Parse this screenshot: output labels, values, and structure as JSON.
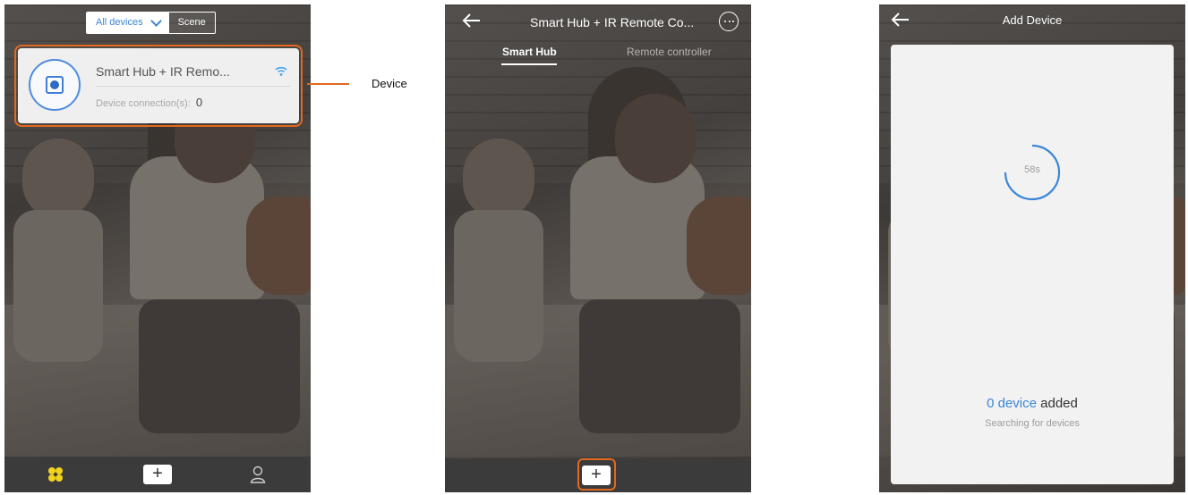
{
  "phone1": {
    "segmented": {
      "all_devices": "All devices",
      "scene": "Scene"
    },
    "device_card": {
      "name": "Smart Hub + IR Remo...",
      "connections_label": "Device connection(s):",
      "connections_count": "0"
    },
    "callout_label": "Device",
    "tabbar": {
      "plus": "+"
    }
  },
  "phone2": {
    "title": "Smart Hub + IR Remote Co...",
    "tabs": [
      "Smart Hub",
      "Remote controller"
    ],
    "plus": "+"
  },
  "phone3": {
    "title": "Add Device",
    "countdown": "58s",
    "added_count": "0 device",
    "added_suffix": " added",
    "searching": "Searching for devices"
  },
  "colors": {
    "accent": "#3a86d8",
    "callout": "#e2691f",
    "tabbar": "#3b3b3b",
    "wifi": "#3fa3ee",
    "flower": "#f2d31b"
  }
}
